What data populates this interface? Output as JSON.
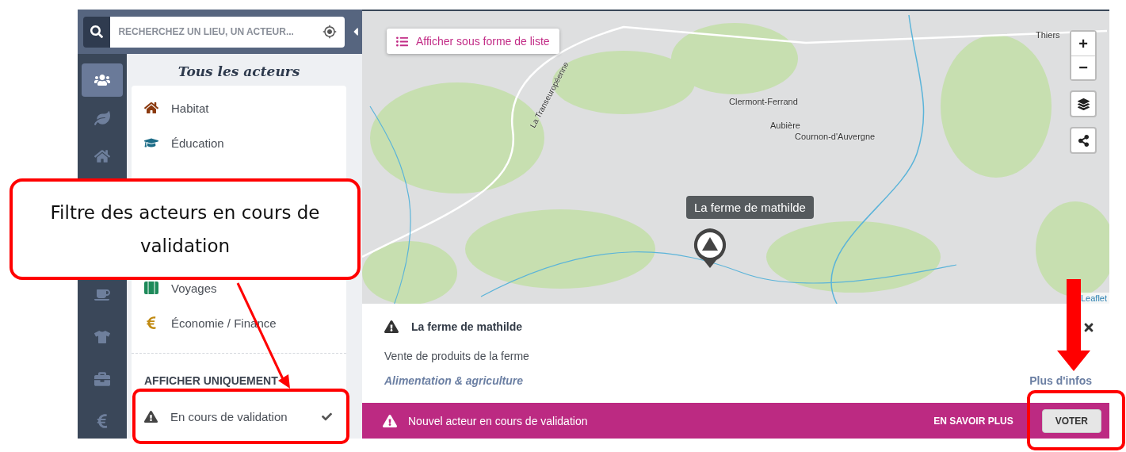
{
  "search": {
    "placeholder": "RECHERCHEZ UN LIEU, UN ACTEUR..."
  },
  "rail": [
    {
      "selected": true
    },
    {
      "selected": false
    },
    {
      "selected": false
    },
    {
      "selected": false
    },
    {
      "selected": false
    },
    {
      "selected": false
    },
    {
      "selected": false
    }
  ],
  "sidebar": {
    "title": "Tous les acteurs",
    "categories": [
      {
        "label": "Habitat",
        "color": "#8b3a0f"
      },
      {
        "label": "Éducation",
        "color": "#1b6b86"
      },
      {
        "label": "Voyages",
        "color": "#1e8a5a"
      },
      {
        "label": "Économie / Finance",
        "color": "#c18a12"
      }
    ],
    "filter_heading": "AFFICHER UNIQUEMENT",
    "filters": [
      {
        "label": "En cours de validation",
        "checked": true
      }
    ]
  },
  "map": {
    "list_button": "Afficher sous forme de liste",
    "places": [
      {
        "label": "Clermont-Ferrand",
        "kind": "city"
      },
      {
        "label": "Aubière",
        "kind": "city"
      },
      {
        "label": "Cournon-d'Auvergne",
        "kind": "city"
      },
      {
        "label": "Thiers",
        "kind": "city"
      },
      {
        "label": "La Transeuropéenne",
        "kind": "road"
      }
    ],
    "marker_tooltip": "La ferme de mathilde",
    "controls": [
      "+",
      "−"
    ],
    "attribution": "Leaflet"
  },
  "info": {
    "title": "La ferme de mathilde",
    "description": "Vente de produits de la ferme",
    "category": "Alimentation & agriculture",
    "more_link": "Plus d'infos"
  },
  "banner": {
    "text": "Nouvel acteur en cours de validation",
    "link": "EN SAVOIR PLUS",
    "button": "VOTER"
  },
  "annotation": {
    "callout": "Filtre des acteurs en cours de validation"
  }
}
